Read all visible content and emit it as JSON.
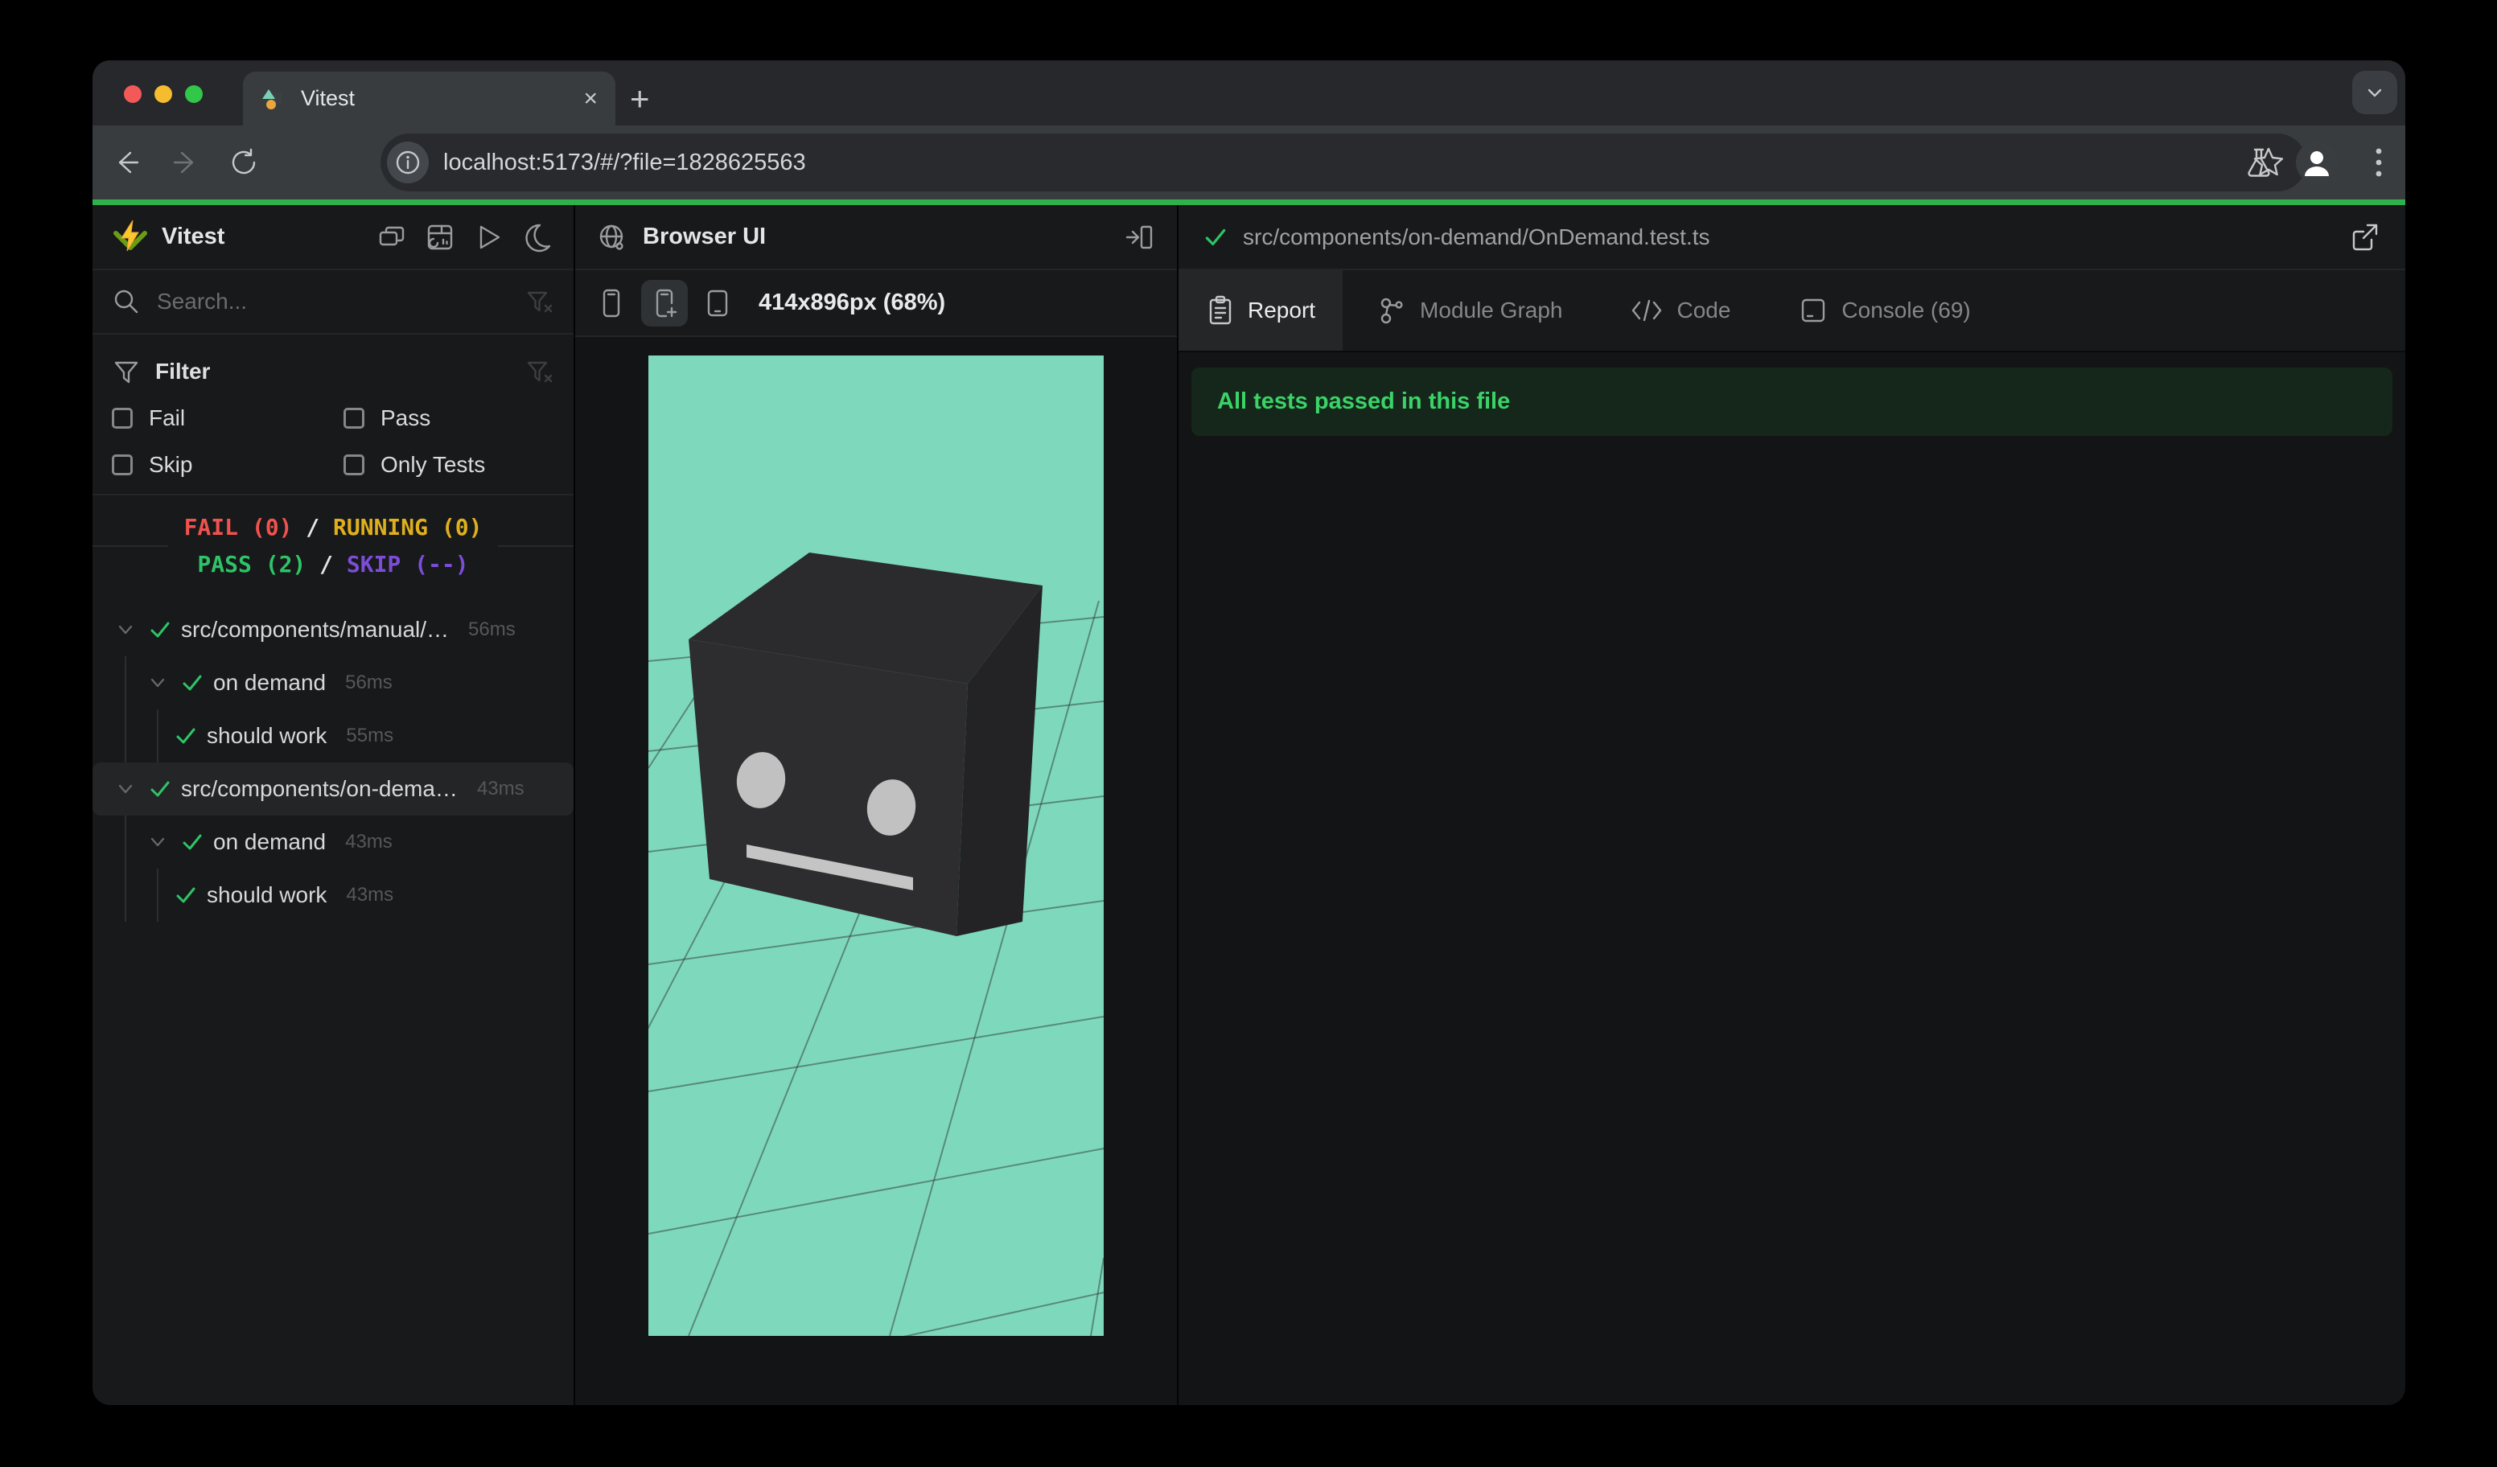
{
  "browser": {
    "tab_title": "Vitest",
    "url": "localhost:5173/#/?file=1828625563",
    "close_glyph": "×",
    "newtab_glyph": "+"
  },
  "sidebar": {
    "title": "Vitest",
    "search_placeholder": "Search...",
    "filter": {
      "title": "Filter",
      "options": [
        "Fail",
        "Pass",
        "Skip",
        "Only Tests"
      ]
    },
    "status": {
      "fail": "FAIL (0)",
      "running": "RUNNING (0)",
      "pass": "PASS (2)",
      "skip": "SKIP (--)",
      "sep": "/"
    },
    "tree": [
      {
        "label": "src/components/manual/…",
        "duration": "56ms",
        "level": 0,
        "status": "pass",
        "expanded": true
      },
      {
        "label": "on demand",
        "duration": "56ms",
        "level": 1,
        "status": "pass",
        "expanded": true
      },
      {
        "label": "should work",
        "duration": "55ms",
        "level": 2,
        "status": "pass"
      },
      {
        "label": "src/components/on-dema…",
        "duration": "43ms",
        "level": 0,
        "status": "pass",
        "expanded": true,
        "selected": true
      },
      {
        "label": "on demand",
        "duration": "43ms",
        "level": 1,
        "status": "pass",
        "expanded": true
      },
      {
        "label": "should work",
        "duration": "43ms",
        "level": 2,
        "status": "pass"
      }
    ]
  },
  "middle": {
    "title": "Browser UI",
    "dimensions": "414x896px (68%)",
    "device_buttons": [
      "phone",
      "phone-add (active)",
      "tablet"
    ]
  },
  "right": {
    "file_path": "src/components/on-demand/OnDemand.test.ts",
    "tabs": [
      "Report",
      "Module Graph",
      "Code",
      "Console (69)"
    ],
    "active_tab": "Report",
    "banner": "All tests passed in this file"
  },
  "icons": [
    "vitest-logo",
    "cascade-windows",
    "dashboard",
    "play",
    "moon",
    "search",
    "funnel",
    "funnel-clear",
    "chevron-down",
    "check",
    "globe",
    "panel-expand",
    "clipboard-report",
    "module-graph",
    "code-brackets",
    "console-terminal",
    "external-link",
    "back-arrow",
    "forward-arrow",
    "reload",
    "site-info",
    "bookmark-star",
    "flask",
    "profile",
    "menu-dots"
  ],
  "colors": {
    "accent_green": "#2eb24b",
    "viewport_teal": "#7ed9bc",
    "fail_red": "#ef5350",
    "running_yellow": "#dfaf1f",
    "pass_green": "#2ec467",
    "skip_purple": "#7d4dd8",
    "banner_bg": "#15271b",
    "banner_text": "#3bd368",
    "panel_bg": "#17191a"
  }
}
